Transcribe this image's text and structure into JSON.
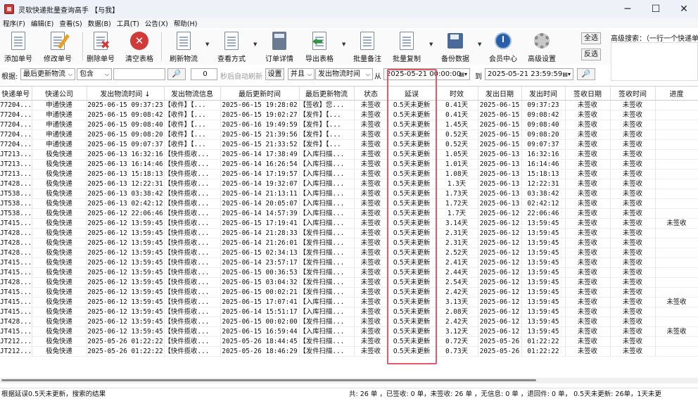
{
  "window": {
    "title": "灵软快递批量查询高手 【与我】",
    "minimize": "─",
    "maximize": "☐",
    "close": "✕"
  },
  "menu": [
    "程序(F)",
    "编辑(E)",
    "查看(S)",
    "数据(B)",
    "工具(T)",
    "公告(X)",
    "帮助(H)"
  ],
  "toolbar": {
    "add": "添加单号",
    "edit": "修改单号",
    "delete": "删除单号",
    "clear": "清空表格",
    "refresh": "刷新物流",
    "view_mode": "查看方式",
    "order_detail": "订单详情",
    "export": "导出表格",
    "batch_note": "批量备注",
    "batch_copy": "批量复制",
    "backup": "备份数据",
    "member": "会员中心",
    "advanced": "高级设置",
    "select_all": "全选",
    "invert": "反选",
    "adv_search_label": "高级搜索：（一行一个快递单"
  },
  "filter": {
    "by_label": "根据:",
    "by_value": "最后更新物流",
    "match_value": "包含",
    "keyword": "",
    "search_icon": "🔎",
    "auto_refresh_value": "0",
    "auto_refresh_label": "秒后自动刷新",
    "settings": "设置",
    "logic_value": "并且",
    "time_field_value": "发出物流时间",
    "from_label": "从",
    "from_value": "2025-05-21 00:00:00",
    "to_label": "到",
    "to_value": "2025-05-21 23:59:59"
  },
  "table": {
    "columns": [
      "快递单号",
      "快递公司",
      "发出物流时间 ↓",
      "发出物流信息",
      "最后更新时间",
      "最后更新物流",
      "状态",
      "延误",
      "时效",
      "发出日期",
      "发出时间",
      "签收日期",
      "签收时间",
      "进度"
    ],
    "rows": [
      [
        "77204...",
        "申通快递",
        "2025-06-15 09:37:23",
        "【收件】【...",
        "2025-06-15 19:28:02",
        "【签收】您...",
        "未签收",
        "0.5天未更新",
        "0.41天",
        "2025-06-15",
        "09:37:23",
        "未签收",
        "未签收",
        ""
      ],
      [
        "77204...",
        "申通快递",
        "2025-06-15 09:08:42",
        "【收件】【...",
        "2025-06-15 19:02:27",
        "【发件】【...",
        "未签收",
        "0.5天未更新",
        "0.41天",
        "2025-06-15",
        "09:08:42",
        "未签收",
        "未签收",
        ""
      ],
      [
        "77204...",
        "申通快递",
        "2025-06-15 09:08:40",
        "【收件】【...",
        "2025-06-16 19:49:59",
        "【发件】【...",
        "未签收",
        "0.5天未更新",
        "1.45天",
        "2025-06-15",
        "09:08:40",
        "未签收",
        "未签收",
        ""
      ],
      [
        "77204...",
        "申通快递",
        "2025-06-15 09:08:20",
        "【收件】【...",
        "2025-06-15 21:39:56",
        "【发件】【...",
        "未签收",
        "0.5天未更新",
        "0.52天",
        "2025-06-15",
        "09:08:20",
        "未签收",
        "未签收",
        ""
      ],
      [
        "77204...",
        "申通快递",
        "2025-06-15 09:07:37",
        "【收件】【...",
        "2025-06-15 21:33:52",
        "【发件】【...",
        "未签收",
        "0.5天未更新",
        "0.52天",
        "2025-06-15",
        "09:07:37",
        "未签收",
        "未签收",
        ""
      ],
      [
        "JT213...",
        "极兔快递",
        "2025-06-13 16:32:16",
        "【快件揽收...",
        "2025-06-14 17:38:49",
        "【入库扫描...",
        "未签收",
        "0.5天未更新",
        "1.05天",
        "2025-06-13",
        "16:32:16",
        "未签收",
        "未签收",
        ""
      ],
      [
        "JT213...",
        "极兔快递",
        "2025-06-13 16:14:46",
        "【快件揽收...",
        "2025-06-14 16:26:54",
        "【入库扫描...",
        "未签收",
        "0.5天未更新",
        "1.01天",
        "2025-06-13",
        "16:14:46",
        "未签收",
        "未签收",
        ""
      ],
      [
        "JT213...",
        "极兔快递",
        "2025-06-13 15:18:13",
        "【快件揽收...",
        "2025-06-14 17:19:57",
        "【入库扫描...",
        "未签收",
        "0.5天未更新",
        "1.08天",
        "2025-06-13",
        "15:18:13",
        "未签收",
        "未签收",
        ""
      ],
      [
        "JT428...",
        "极兔快递",
        "2025-06-13 12:22:31",
        "【快件揽收...",
        "2025-06-14 19:32:07",
        "【入库扫描...",
        "未签收",
        "0.5天未更新",
        "1.3天",
        "2025-06-13",
        "12:22:31",
        "未签收",
        "未签收",
        ""
      ],
      [
        "JT538...",
        "极兔快递",
        "2025-06-13 03:38:42",
        "【快件揽收...",
        "2025-06-14 21:13:11",
        "【入库扫描...",
        "未签收",
        "0.5天未更新",
        "1.73天",
        "2025-06-13",
        "03:38:42",
        "未签收",
        "未签收",
        ""
      ],
      [
        "JT538...",
        "极兔快递",
        "2025-06-13 02:42:12",
        "【快件揽收...",
        "2025-06-14 20:05:07",
        "【入库扫描...",
        "未签收",
        "0.5天未更新",
        "1.72天",
        "2025-06-13",
        "02:42:12",
        "未签收",
        "未签收",
        ""
      ],
      [
        "JT538...",
        "极兔快递",
        "2025-06-12 22:06:46",
        "【快件揽收...",
        "2025-06-14 14:57:39",
        "【入库扫描...",
        "未签收",
        "0.5天未更新",
        "1.7天",
        "2025-06-12",
        "22:06:46",
        "未签收",
        "未签收",
        ""
      ],
      [
        "JT415...",
        "极兔快递",
        "2025-06-12 13:59:45",
        "【快件揽收...",
        "2025-06-15 17:19:41",
        "【入库扫描...",
        "未签收",
        "0.5天未更新",
        "3.14天",
        "2025-06-12",
        "13:59:45",
        "未签收",
        "未签收",
        "未签收"
      ],
      [
        "JT428...",
        "极兔快递",
        "2025-06-12 13:59:45",
        "【快件揽收...",
        "2025-06-14 21:28:33",
        "【发件扫描...",
        "未签收",
        "0.5天未更新",
        "2.31天",
        "2025-06-12",
        "13:59:45",
        "未签收",
        "未签收",
        ""
      ],
      [
        "JT428...",
        "极兔快递",
        "2025-06-12 13:59:45",
        "【快件揽收...",
        "2025-06-14 21:26:01",
        "【发件扫描...",
        "未签收",
        "0.5天未更新",
        "2.31天",
        "2025-06-12",
        "13:59:45",
        "未签收",
        "未签收",
        ""
      ],
      [
        "JT428...",
        "极兔快递",
        "2025-06-12 13:59:45",
        "【快件揽收...",
        "2025-06-15 02:34:13",
        "【发件扫描...",
        "未签收",
        "0.5天未更新",
        "2.52天",
        "2025-06-12",
        "13:59:45",
        "未签收",
        "未签收",
        ""
      ],
      [
        "JT415...",
        "极兔快递",
        "2025-06-12 13:59:45",
        "【快件揽收...",
        "2025-06-14 23:57:17",
        "【发件扫描...",
        "未签收",
        "0.5天未更新",
        "2.41天",
        "2025-06-12",
        "13:59:45",
        "未签收",
        "未签收",
        ""
      ],
      [
        "JT415...",
        "极兔快递",
        "2025-06-12 13:59:45",
        "【快件揽收...",
        "2025-06-15 00:36:53",
        "【发件扫描...",
        "未签收",
        "0.5天未更新",
        "2.44天",
        "2025-06-12",
        "13:59:45",
        "未签收",
        "未签收",
        ""
      ],
      [
        "JT428...",
        "极兔快递",
        "2025-06-12 13:59:45",
        "【快件揽收...",
        "2025-06-15 03:04:32",
        "【发件扫描...",
        "未签收",
        "0.5天未更新",
        "2.54天",
        "2025-06-12",
        "13:59:45",
        "未签收",
        "未签收",
        ""
      ],
      [
        "JT415...",
        "极兔快递",
        "2025-06-12 13:59:45",
        "【快件揽收...",
        "2025-06-15 00:02:21",
        "【发件扫描...",
        "未签收",
        "0.5天未更新",
        "2.42天",
        "2025-06-12",
        "13:59:45",
        "未签收",
        "未签收",
        ""
      ],
      [
        "JT415...",
        "极兔快递",
        "2025-06-12 13:59:45",
        "【快件揽收...",
        "2025-06-15 17:07:41",
        "【入库扫描...",
        "未签收",
        "0.5天未更新",
        "3.13天",
        "2025-06-12",
        "13:59:45",
        "未签收",
        "未签收",
        "未签收"
      ],
      [
        "JT415...",
        "极兔快递",
        "2025-06-12 13:59:45",
        "【快件揽收...",
        "2025-06-14 15:51:17",
        "【入库扫描...",
        "未签收",
        "0.5天未更新",
        "2.08天",
        "2025-06-12",
        "13:59:45",
        "未签收",
        "未签收",
        ""
      ],
      [
        "JT428...",
        "极兔快递",
        "2025-06-12 13:59:45",
        "【快件揽收...",
        "2025-06-15 00:02:00",
        "【发件扫描...",
        "未签收",
        "0.5天未更新",
        "2.42天",
        "2025-06-12",
        "13:59:45",
        "未签收",
        "未签收",
        ""
      ],
      [
        "JT415...",
        "极兔快递",
        "2025-06-12 13:59:45",
        "【快件揽收...",
        "2025-06-15 16:59:44",
        "【入库扫描...",
        "未签收",
        "0.5天未更新",
        "3.12天",
        "2025-06-12",
        "13:59:45",
        "未签收",
        "未签收",
        "未签收"
      ],
      [
        "JT212...",
        "极兔快递",
        "2025-05-26 01:22:22",
        "【快件揽收...",
        "2025-05-26 18:44:45",
        "【发件扫描...",
        "未签收",
        "0.5天未更新",
        "0.72天",
        "2025-05-26",
        "01:22:22",
        "未签收",
        "未签收",
        ""
      ],
      [
        "JT212...",
        "极兔快递",
        "2025-05-26 01:22:22",
        "【快件揽收...",
        "2025-05-26 18:46:29",
        "【发件扫描...",
        "未签收",
        "0.5天未更新",
        "0.73天",
        "2025-05-26",
        "01:22:22",
        "未签收",
        "未签收",
        ""
      ]
    ]
  },
  "status": {
    "left": "根据延误0.5天未更新，搜索的结果",
    "right": "共: 26 单 ，已签收: 0 单，未签收: 26 单 ，无信息: 0 单 ，退回件: 0 单， 0.5天未更新: 26单，1天未更"
  },
  "colors": {
    "highlight": "#e05a6a",
    "delete_x": "#d23a3a",
    "member_blue": "#2a5fa8"
  }
}
